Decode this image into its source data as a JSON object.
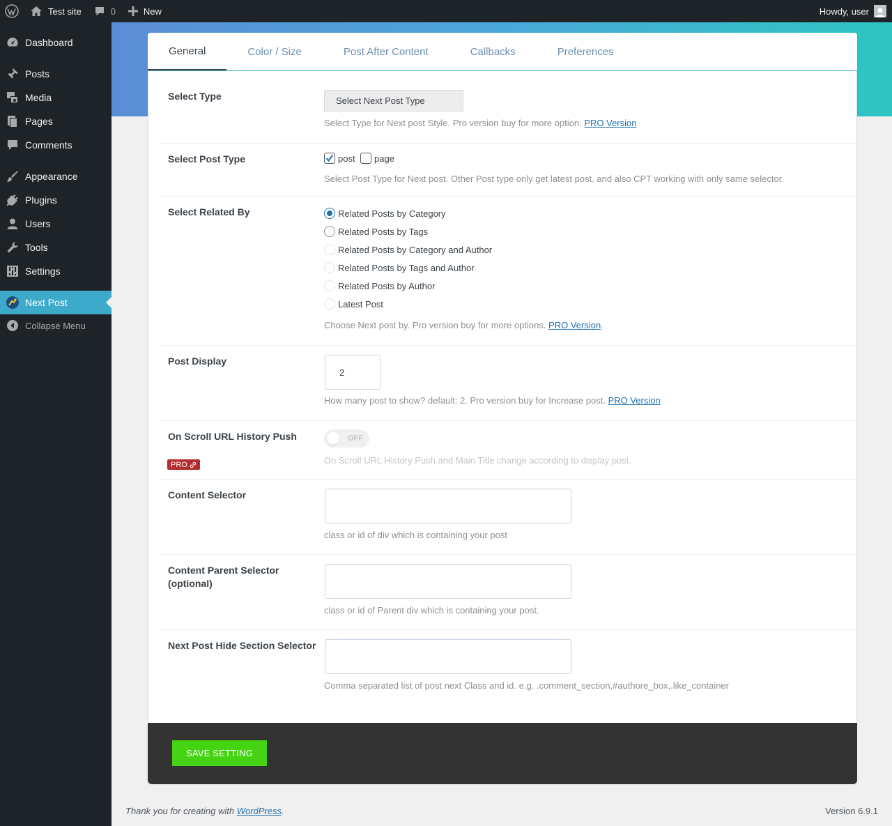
{
  "adminbar": {
    "site_name": "Test site",
    "comments_count": "0",
    "new_label": "New",
    "howdy": "Howdy, user"
  },
  "sidebar": {
    "items": [
      {
        "label": "Dashboard",
        "icon": "dashboard-icon"
      },
      {
        "label": "Posts",
        "icon": "pin-icon"
      },
      {
        "label": "Media",
        "icon": "media-icon"
      },
      {
        "label": "Pages",
        "icon": "pages-icon"
      },
      {
        "label": "Comments",
        "icon": "comment-icon"
      },
      {
        "label": "Appearance",
        "icon": "brush-icon"
      },
      {
        "label": "Plugins",
        "icon": "plug-icon"
      },
      {
        "label": "Users",
        "icon": "user-icon"
      },
      {
        "label": "Tools",
        "icon": "wrench-icon"
      },
      {
        "label": "Settings",
        "icon": "sliders-icon"
      },
      {
        "label": "Next Post",
        "icon": "next-post-icon"
      }
    ],
    "collapse_label": "Collapse Menu"
  },
  "tabs": [
    "General",
    "Color / Size",
    "Post After Content",
    "Callbacks",
    "Preferences"
  ],
  "settings": {
    "select_type": {
      "label": "Select Type",
      "button": "Select Next Post Type",
      "desc": "Select Type for Next post Style. Pro version buy for more option.",
      "pro_link": "PRO Version"
    },
    "post_type": {
      "label": "Select Post Type",
      "option_post": "post",
      "option_page": "page",
      "desc": "Select Post Type for Next post. Other Post type only get latest post. and also CPT working with only same selector."
    },
    "related_by": {
      "label": "Select Related By",
      "options": [
        "Related Posts by Category",
        "Related Posts by Tags",
        "Related Posts by Category and Author",
        "Related Posts by Tags and Author",
        "Related Posts by Author",
        "Latest Post"
      ],
      "desc": "Choose Next post by. Pro version buy for more options.",
      "pro_link": "PRO Version",
      "period": "."
    },
    "post_display": {
      "label": "Post Display",
      "value": "2",
      "desc": "How many post to show? default: 2. Pro version buy for Increase post.",
      "pro_link": "PRO Version"
    },
    "scroll_push": {
      "label": "On Scroll URL History Push",
      "toggle": "OFF",
      "badge": "PRO",
      "desc": "On Scroll URL History Push and Main Title change according to display post."
    },
    "content_selector": {
      "label": "Content Selector",
      "desc": "class or id of div which is containing your post"
    },
    "parent_selector": {
      "label": "Content Parent Selector (optional)",
      "desc": "class or id of Parent div which is containing your post."
    },
    "hide_selector": {
      "label": "Next Post Hide Section Selector",
      "desc": "Comma separated list of post next Class and id. e.g. .comment_section,#authore_box,.like_container"
    }
  },
  "save_label": "SAVE SETTING",
  "footer": {
    "thanks_prefix": "Thank you for creating with ",
    "wp_link": "WordPress",
    "period": ".",
    "version": "Version 6.9.1"
  },
  "colors": {
    "accent": "#3daacc",
    "save": "#44d412",
    "pro_badge": "#b32d2e"
  }
}
